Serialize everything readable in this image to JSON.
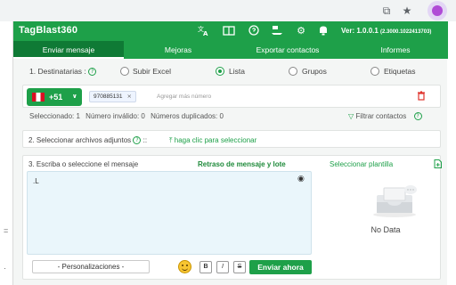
{
  "browser": {
    "icons": [
      "cast-icon",
      "star-icon",
      "extension-icon"
    ]
  },
  "app": {
    "title": "TagBlast360",
    "version": "Ver: 1.0.0.1",
    "build": "(2.3000.1022413703)",
    "accent": "#1ea049"
  },
  "header_icons": [
    "translate-icon",
    "book-icon",
    "support-icon",
    "delivery-icon",
    "settings-icon",
    "bell-icon"
  ],
  "tabs": [
    {
      "label": "Enviar mensaje",
      "active": true
    },
    {
      "label": "Mejoras"
    },
    {
      "label": "Exportar contactos"
    },
    {
      "label": "Informes"
    }
  ],
  "recipients": {
    "label": "1. Destinatarias :",
    "options": [
      "Subir Excel",
      "Lista",
      "Grupos",
      "Etiquetas"
    ],
    "selected": "Lista",
    "country_code": "+51",
    "numbers": [
      "970885131"
    ],
    "placeholder": "Agregar más número",
    "stats": {
      "selected": "Seleccionado: 1",
      "invalid": "Número inválido: 0",
      "duplicates": "Números duplicados: 0"
    },
    "filter": "Filtrar contactos"
  },
  "attachments": {
    "label": "2. Seleccionar archivos adjuntos",
    "separator": "::",
    "link": "haga clic para seleccionar"
  },
  "message": {
    "label": "3. Escriba o seleccione el mensaje",
    "delay_link": "Retraso de mensaje y lote",
    "template_link": "Seleccionar plantilla",
    "content": ".L",
    "personalize": "- Personalizaciones -",
    "format_buttons": [
      "B",
      "I",
      "S"
    ],
    "send": "Enviar ahora"
  },
  "templates": {
    "empty_text": "No Data"
  }
}
